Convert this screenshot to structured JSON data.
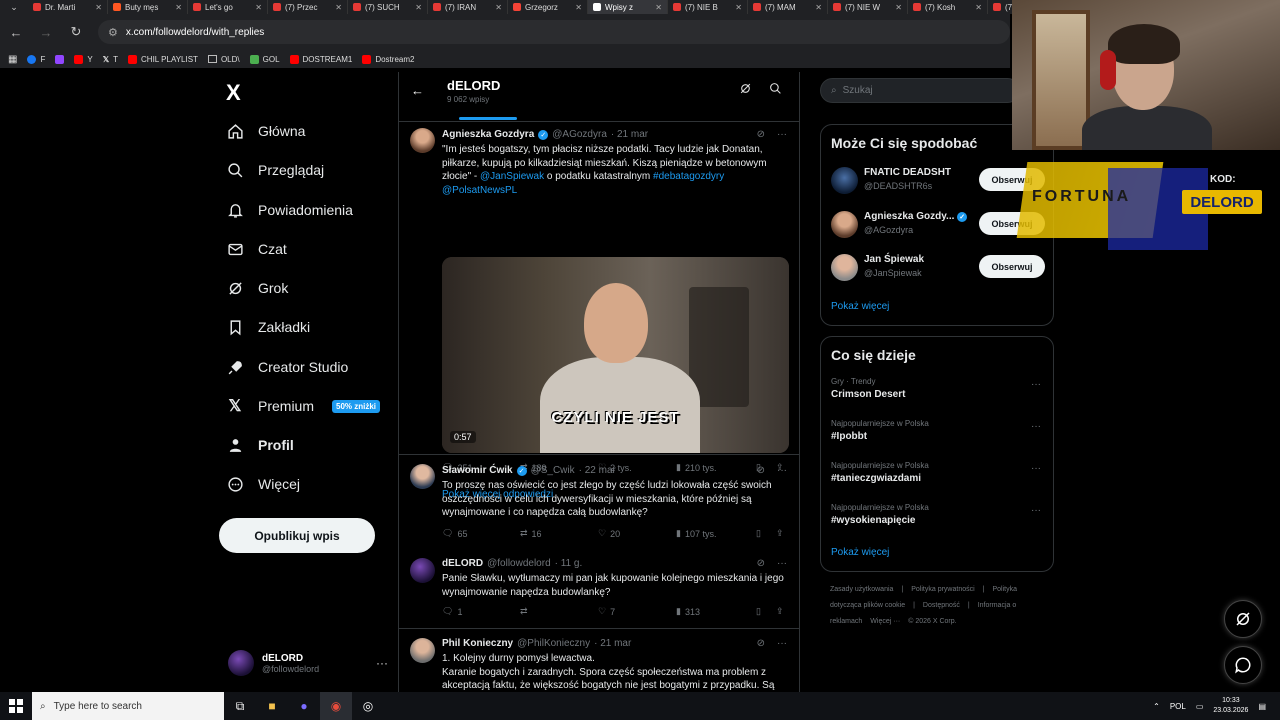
{
  "browser": {
    "tabs": [
      {
        "label": "Dr. Marti",
        "color": "#e53935"
      },
      {
        "label": "Buty męs",
        "color": "#ff5722"
      },
      {
        "label": "Let's go",
        "color": "#e53935"
      },
      {
        "label": "(7) Przec",
        "color": "#e53935"
      },
      {
        "label": "(7) SUCH",
        "color": "#e53935"
      },
      {
        "label": "(7) IRAN",
        "color": "#e53935"
      },
      {
        "label": "Grzegorz",
        "color": "#f44336"
      },
      {
        "label": "Wpisy z",
        "color": "#ffffff",
        "active": true
      },
      {
        "label": "(7) NIE B",
        "color": "#e53935"
      },
      {
        "label": "(7) MAM",
        "color": "#e53935"
      },
      {
        "label": "(7) NIE W",
        "color": "#e53935"
      },
      {
        "label": "(7) Kosh",
        "color": "#e53935"
      },
      {
        "label": "(7)",
        "color": "#e53935"
      }
    ],
    "url": "x.com/followdelord/with_replies",
    "bookmarks": [
      "F",
      "Y",
      "T",
      "CHIL PLAYLIST",
      "OLD\\",
      "GOL",
      "DOSTREAM1",
      "Dostream2"
    ]
  },
  "nav": {
    "logo": "X",
    "items": [
      {
        "label": "Główna",
        "icon": "home-icon",
        "bold": false
      },
      {
        "label": "Przeglądaj",
        "icon": "search-icon",
        "bold": false
      },
      {
        "label": "Powiadomienia",
        "icon": "bell-icon",
        "bold": false
      },
      {
        "label": "Czat",
        "icon": "mail-icon",
        "bold": false
      },
      {
        "label": "Grok",
        "icon": "grok-icon",
        "bold": false
      },
      {
        "label": "Zakładki",
        "icon": "bookmark-icon",
        "bold": false
      },
      {
        "label": "Creator Studio",
        "icon": "rocket-icon",
        "bold": false
      },
      {
        "label": "Premium",
        "icon": "x-logo-icon",
        "bold": false
      },
      {
        "label": "Profil",
        "icon": "person-icon",
        "bold": true
      },
      {
        "label": "Więcej",
        "icon": "more-circle-icon",
        "bold": false
      }
    ],
    "premium_badge": "50% zniżki",
    "post_button": "Opublikuj wpis",
    "account": {
      "name": "dELORD",
      "handle": "@followdelord",
      "more": "···"
    }
  },
  "profile_header": {
    "title": "dELORD",
    "post_count": "9 062 wpisy"
  },
  "tweets": [
    {
      "name": "Agnieszka Gozdyra",
      "handle": "@AGozdyra",
      "time": "· 21 mar",
      "verified": true,
      "text_parts": [
        {
          "t": "\"Im jesteś bogatszy, tym płacisz niższe podatki. Tacy ludzie jak Donatan, piłkarze, kupują po kilkadziesiąt mieszkań. Kiszą pieniądze w betonowym złocie\" - ",
          "link": false
        },
        {
          "t": "@JanSpiewak",
          "link": true
        },
        {
          "t": " o podatku katastralnym ",
          "link": false
        },
        {
          "t": "#debatagozdyry",
          "link": true
        },
        {
          "t": " ",
          "link": false
        },
        {
          "t": "@PolsatNewsPL",
          "link": true
        }
      ],
      "video": {
        "caption": "CZYLI NIE JEST",
        "duration": "0:57"
      },
      "replies": "251",
      "reposts": "189",
      "likes": "2 tys.",
      "views": "210 tys."
    },
    {
      "name": "Sławomir Ćwik",
      "handle": "@S_Cwik",
      "time": "· 22 mar",
      "verified": true,
      "text": "To proszę nas oświecić co jest złego by część ludzi lokowała część swoich oszczędności w celu ich dywersyfikacji w mieszkania, które później są wynajmowane i co napędza całą budowlankę?",
      "replies": "65",
      "reposts": "16",
      "likes": "20",
      "views": "107 tys."
    },
    {
      "name": "dELORD",
      "handle": "@followdelord",
      "time": "· 11 g.",
      "verified": false,
      "text": "Panie Sławku, wytłumaczy mi pan jak kupowanie kolejnego mieszkania i jego wynajmowanie napędza budowlankę?",
      "replies": "1",
      "reposts": "",
      "likes": "7",
      "views": "313"
    },
    {
      "name": "Phil Konieczny",
      "handle": "@PhilKonieczny",
      "time": "· 21 mar",
      "verified": false,
      "text": "1. Kolejny durny pomysł lewactwa.\nKaranie bogatych i zaradnych.    Spora część społeczeństwa ma problem z akceptacją faktu, że większość bogatych nie jest bogatymi z przypadku. Są"
    }
  ],
  "show_more_replies": "Pokaż więcej odpowiedzi",
  "sidebar": {
    "search_placeholder": "Szukaj",
    "who_to_follow": {
      "title": "Może Ci się spodobać",
      "accounts": [
        {
          "name": "FNATIC DEADSHT",
          "handle": "@DEADSHTR6s",
          "button": "Obserwuj",
          "verified": false
        },
        {
          "name": "Agnieszka Gozdy...",
          "handle": "@AGozdyra",
          "button": "Obserwuj",
          "verified": true
        },
        {
          "name": "Jan Śpiewak",
          "handle": "@JanSpiewak",
          "button": "Obserwuj",
          "verified": false
        }
      ],
      "show_more": "Pokaż więcej"
    },
    "trends": {
      "title": "Co się dzieje",
      "items": [
        {
          "context": "Gry · Trendy",
          "label": "Crimson Desert"
        },
        {
          "context": "Najpopularniejsze w Polska",
          "label": "#Ipobbt"
        },
        {
          "context": "Najpopularniejsze w Polska",
          "label": "#tanieczgwiazdami"
        },
        {
          "context": "Najpopularniejsze w Polska",
          "label": "#wysokienapięcie"
        }
      ],
      "show_more": "Pokaż więcej"
    },
    "footer": [
      "Zasady użytkowania",
      "|",
      "Polityka prywatności",
      "|",
      "Polityka dotycząca plików cookie",
      "|",
      "Dostępność",
      "|",
      "Informacja o reklamach",
      "Więcej ···",
      "© 2026 X Corp."
    ]
  },
  "overlay": {
    "sponsor": "FORTUNA",
    "promo_label": "KOD:",
    "promo_code": "DELORD"
  },
  "taskbar": {
    "search_placeholder": "Type here to search",
    "lang": "POL",
    "time": "10:33",
    "date": "23.03.2026"
  }
}
